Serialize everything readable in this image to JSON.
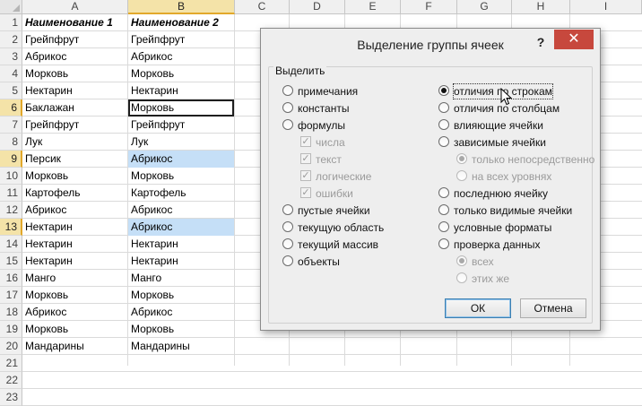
{
  "sheet": {
    "columns": [
      "A",
      "B",
      "C",
      "D",
      "E",
      "F",
      "G",
      "H",
      "I"
    ],
    "rows": [
      "1",
      "2",
      "3",
      "4",
      "5",
      "6",
      "7",
      "8",
      "9",
      "10",
      "11",
      "12",
      "13",
      "14",
      "15",
      "16",
      "17",
      "18",
      "19",
      "20",
      "21",
      "22",
      "23"
    ],
    "cells": [
      [
        "Наименование 1",
        "Наименование 2"
      ],
      [
        "Грейпфрут",
        "Грейпфрут"
      ],
      [
        "Абрикос",
        "Абрикос"
      ],
      [
        "Морковь",
        "Морковь"
      ],
      [
        "Нектарин",
        "Нектарин"
      ],
      [
        "Баклажан",
        "Морковь"
      ],
      [
        "Грейпфрут",
        "Грейпфрут"
      ],
      [
        "Лук",
        "Лук"
      ],
      [
        "Персик",
        "Абрикос"
      ],
      [
        "Морковь",
        "Морковь"
      ],
      [
        "Картофель",
        "Картофель"
      ],
      [
        "Абрикос",
        "Абрикос"
      ],
      [
        "Нектарин",
        "Абрикос"
      ],
      [
        "Нектарин",
        "Нектарин"
      ],
      [
        "Нектарин",
        "Нектарин"
      ],
      [
        "Манго",
        "Манго"
      ],
      [
        "Морковь",
        "Морковь"
      ],
      [
        "Абрикос",
        "Абрикос"
      ],
      [
        "Морковь",
        "Морковь"
      ],
      [
        "Мандарины",
        "Мандарины"
      ]
    ],
    "highlighted_rows": [
      6,
      9,
      13
    ],
    "active_row": 6,
    "selected_column": "B"
  },
  "dialog": {
    "title": "Выделение группы ячеек",
    "help": "?",
    "close": "✕",
    "group_label": "Выделить",
    "left_options": [
      {
        "label": "примечания",
        "type": "radio",
        "checked": false,
        "disabled": false
      },
      {
        "label": "константы",
        "type": "radio",
        "checked": false,
        "disabled": false
      },
      {
        "label": "формулы",
        "type": "radio",
        "checked": false,
        "disabled": false
      },
      {
        "label": "числа",
        "type": "check",
        "checked": true,
        "disabled": true
      },
      {
        "label": "текст",
        "type": "check",
        "checked": true,
        "disabled": true
      },
      {
        "label": "логические",
        "type": "check",
        "checked": true,
        "disabled": true
      },
      {
        "label": "ошибки",
        "type": "check",
        "checked": true,
        "disabled": true
      },
      {
        "label": "пустые ячейки",
        "type": "radio",
        "checked": false,
        "disabled": false
      },
      {
        "label": "текущую область",
        "type": "radio",
        "checked": false,
        "disabled": false
      },
      {
        "label": "текущий массив",
        "type": "radio",
        "checked": false,
        "disabled": false
      },
      {
        "label": "объекты",
        "type": "radio",
        "checked": false,
        "disabled": false
      }
    ],
    "right_options": [
      {
        "label": "отличия по строкам",
        "type": "radio",
        "checked": true,
        "disabled": false
      },
      {
        "label": "отличия по столбцам",
        "type": "radio",
        "checked": false,
        "disabled": false
      },
      {
        "label": "влияющие ячейки",
        "type": "radio",
        "checked": false,
        "disabled": false
      },
      {
        "label": "зависимые ячейки",
        "type": "radio",
        "checked": false,
        "disabled": false
      },
      {
        "label": "только непосредственно",
        "type": "radio",
        "checked": true,
        "disabled": true
      },
      {
        "label": "на всех уровнях",
        "type": "radio",
        "checked": false,
        "disabled": true
      },
      {
        "label": "последнюю ячейку",
        "type": "radio",
        "checked": false,
        "disabled": false
      },
      {
        "label": "только видимые ячейки",
        "type": "radio",
        "checked": false,
        "disabled": false
      },
      {
        "label": "условные форматы",
        "type": "radio",
        "checked": false,
        "disabled": false
      },
      {
        "label": "проверка данных",
        "type": "radio",
        "checked": false,
        "disabled": false
      },
      {
        "label": "всех",
        "type": "radio",
        "checked": true,
        "disabled": true
      },
      {
        "label": "этих же",
        "type": "radio",
        "checked": false,
        "disabled": true
      }
    ],
    "ok_label": "ОК",
    "cancel_label": "Отмена"
  },
  "colors": {
    "highlight": "#c5dff7",
    "header_selected": "#f4e3a8",
    "close_button": "#c7483d"
  }
}
